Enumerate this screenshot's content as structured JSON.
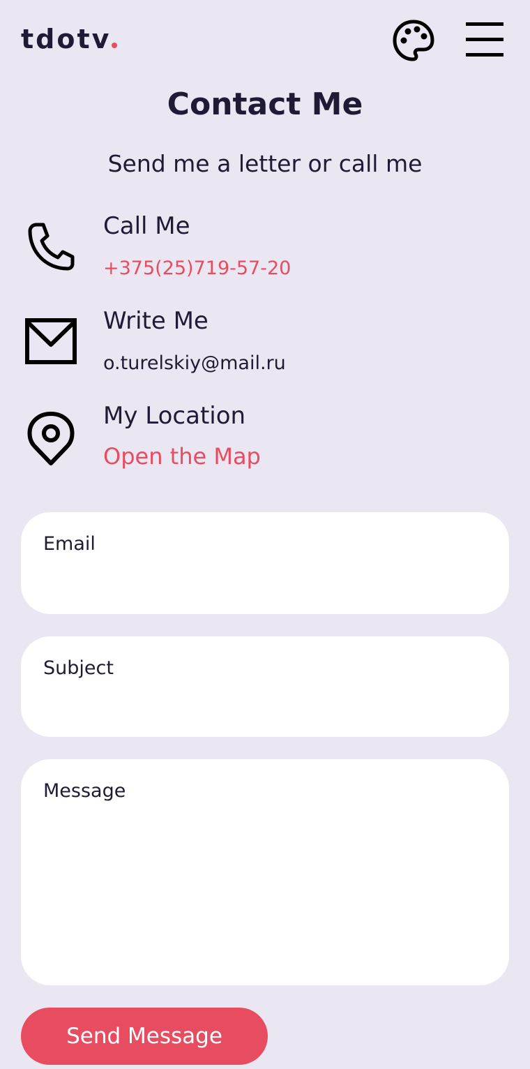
{
  "header": {
    "logo_text": "tdotv",
    "palette_icon": "palette-icon",
    "menu_icon": "hamburger-menu-icon"
  },
  "main": {
    "title": "Contact Me",
    "subtitle": "Send me a letter or call me"
  },
  "contacts": [
    {
      "icon": "phone-icon",
      "label": "Call Me",
      "value": "+375(25)719-57-20"
    },
    {
      "icon": "mail-icon",
      "label": "Write Me",
      "value": "o.turelskiy@mail.ru"
    },
    {
      "icon": "location-pin-icon",
      "label": "My Location",
      "value": "Open the Map"
    }
  ],
  "form": {
    "email_label": "Email",
    "email_value": "",
    "subject_label": "Subject",
    "subject_value": "",
    "message_label": "Message",
    "message_value": "",
    "submit_label": "Send Message"
  },
  "colors": {
    "background": "#ebe7f2",
    "text": "#1f1b34",
    "accent": "#e84c60",
    "field_bg": "#ffffff"
  }
}
